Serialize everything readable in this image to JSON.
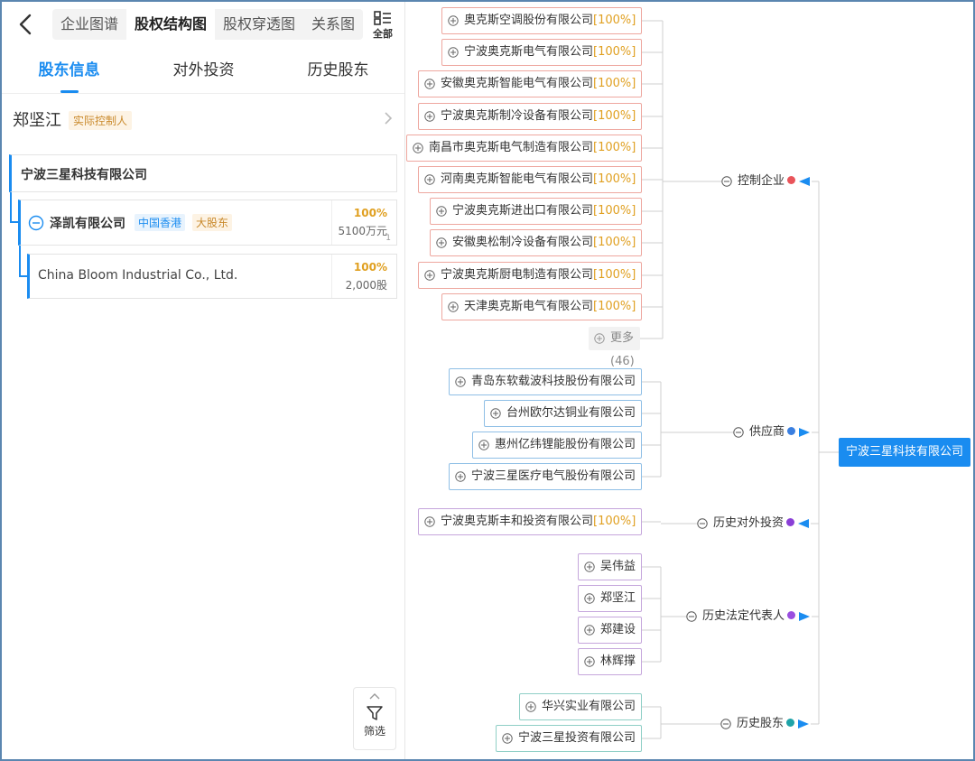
{
  "topbar": {
    "view_tabs": [
      "企业图谱",
      "股权结构图",
      "股权穿透图",
      "关系图"
    ],
    "active_view_tab": "股权结构图",
    "all_label": "全部"
  },
  "sub_tabs": [
    {
      "label": "股东信息",
      "active": true
    },
    {
      "label": "对外投资",
      "active": false
    },
    {
      "label": "历史股东",
      "active": false
    }
  ],
  "controller": {
    "name": "郑坚江",
    "badge": "实际控制人"
  },
  "company": {
    "name": "宁波三星科技有限公司"
  },
  "shareholders": [
    {
      "name": "泽凯有限公司",
      "region_tag": "中国香港",
      "role_tag": "大股东",
      "percent": "100%",
      "amount": "5100万元",
      "index": "1"
    },
    {
      "name": "China Bloom Industrial Co., Ltd.",
      "percent": "100%",
      "amount": "2,000股"
    }
  ],
  "filter": {
    "label": "筛选"
  },
  "tree": {
    "root": "宁波三星科技有限公司",
    "categories": [
      {
        "key": "control",
        "label": "控制企业",
        "color": "#e9545a",
        "theme": "red",
        "children": [
          {
            "name": "奥克斯空调股份有限公司",
            "pct": "100%"
          },
          {
            "name": "宁波奥克斯电气有限公司",
            "pct": "100%"
          },
          {
            "name": "安徽奥克斯智能电气有限公司",
            "pct": "100%"
          },
          {
            "name": "宁波奥克斯制冷设备有限公司",
            "pct": "100%"
          },
          {
            "name": "南昌市奥克斯电气制造有限公司",
            "pct": "100%"
          },
          {
            "name": "河南奥克斯智能电气有限公司",
            "pct": "100%"
          },
          {
            "name": "宁波奥克斯进出口有限公司",
            "pct": "100%"
          },
          {
            "name": "安徽奥松制冷设备有限公司",
            "pct": "100%"
          },
          {
            "name": "宁波奥克斯厨电制造有限公司",
            "pct": "100%"
          },
          {
            "name": "天津奥克斯电气有限公司",
            "pct": "100%"
          }
        ],
        "more_label": "更多(46)"
      },
      {
        "key": "supplier",
        "label": "供应商",
        "color": "#3a7fe0",
        "theme": "blue",
        "children": [
          {
            "name": "青岛东软载波科技股份有限公司"
          },
          {
            "name": "台州欧尔达铜业有限公司"
          },
          {
            "name": "惠州亿纬锂能股份有限公司"
          },
          {
            "name": "宁波三星医疗电气股份有限公司"
          }
        ]
      },
      {
        "key": "history_invest",
        "label": "历史对外投资",
        "color": "#8a3fd6",
        "theme": "purple",
        "children": [
          {
            "name": "宁波奥克斯丰和投资有限公司",
            "pct": "100%"
          }
        ]
      },
      {
        "key": "history_legal",
        "label": "历史法定代表人",
        "color": "#9a4fe0",
        "theme": "purple",
        "children": [
          {
            "name": "吴伟益"
          },
          {
            "name": "郑坚江"
          },
          {
            "name": "郑建设"
          },
          {
            "name": "林辉撑"
          }
        ]
      },
      {
        "key": "history_shareholder",
        "label": "历史股东",
        "color": "#1fa3a8",
        "theme": "teal",
        "children": [
          {
            "name": "华兴实业有限公司"
          },
          {
            "name": "宁波三星投资有限公司"
          }
        ]
      }
    ]
  },
  "colors": {
    "accent": "#1a8cf0",
    "percent": "#e0a021",
    "tag_orange": "#c9892b"
  }
}
